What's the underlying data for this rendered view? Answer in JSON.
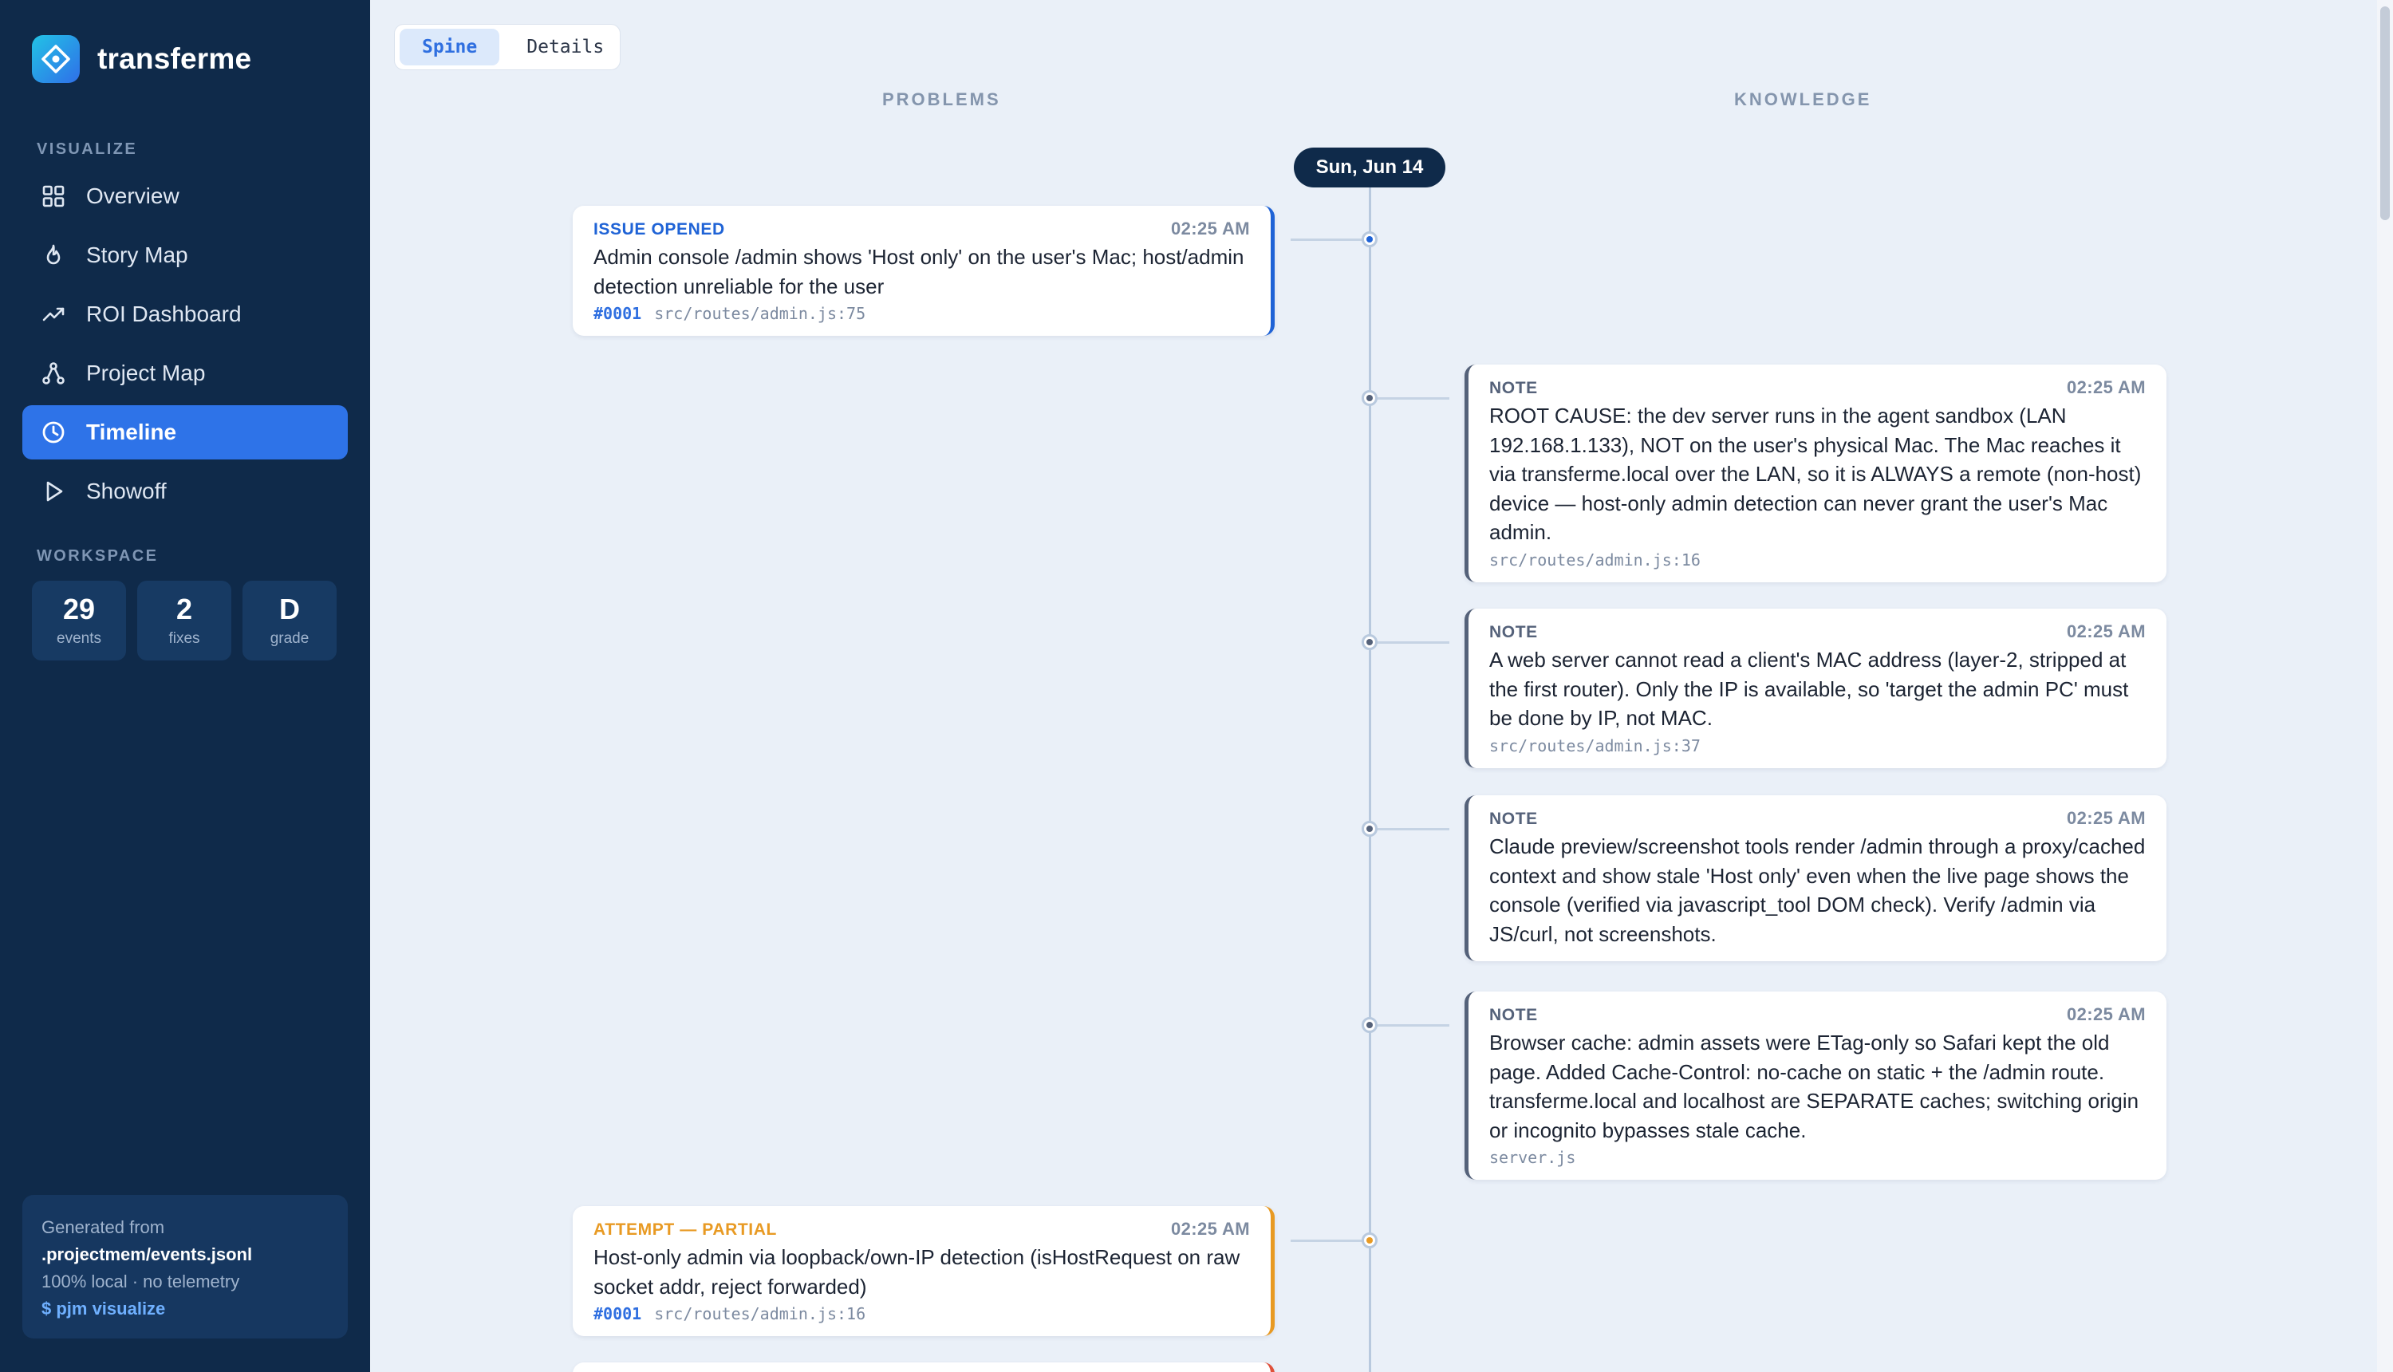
{
  "brand": {
    "name": "transferme"
  },
  "sidebar": {
    "visualize_label": "VISUALIZE",
    "nav": [
      {
        "label": "Overview",
        "icon": "grid-icon"
      },
      {
        "label": "Story Map",
        "icon": "flame-icon"
      },
      {
        "label": "ROI Dashboard",
        "icon": "trend-up-icon"
      },
      {
        "label": "Project Map",
        "icon": "graph-nodes-icon"
      },
      {
        "label": "Timeline",
        "icon": "clock-icon",
        "active": true
      },
      {
        "label": "Showoff",
        "icon": "play-icon"
      }
    ],
    "workspace_label": "WORKSPACE",
    "stats": [
      {
        "value": "29",
        "label": "events"
      },
      {
        "value": "2",
        "label": "fixes"
      },
      {
        "value": "D",
        "label": "grade"
      }
    ],
    "generated": {
      "line1": "Generated from",
      "file": ".projectmem/events.jsonl",
      "line3": "100% local · no telemetry",
      "command": "$ pjm visualize"
    }
  },
  "toggle": {
    "spine": "Spine",
    "details": "Details"
  },
  "columns": {
    "problems": "PROBLEMS",
    "knowledge": "KNOWLEDGE"
  },
  "date": "Sun, Jun 14",
  "events": [
    {
      "type": "ISSUE OPENED",
      "time": "02:25 AM",
      "text": "Admin console /admin shows 'Host only' on the user's Mac; host/admin detection unreliable for the user",
      "ref": "#0001",
      "file": "src/routes/admin.js:75"
    },
    {
      "type": "NOTE",
      "time": "02:25 AM",
      "text": "ROOT CAUSE: the dev server runs in the agent sandbox (LAN 192.168.1.133), NOT on the user's physical Mac. The Mac reaches it via transferme.local over the LAN, so it is ALWAYS a remote (non-host) device — host-only admin detection can never grant the user's Mac admin.",
      "file": "src/routes/admin.js:16"
    },
    {
      "type": "NOTE",
      "time": "02:25 AM",
      "text": "A web server cannot read a client's MAC address (layer-2, stripped at the first router). Only the IP is available, so 'target the admin PC' must be done by IP, not MAC.",
      "file": "src/routes/admin.js:37"
    },
    {
      "type": "NOTE",
      "time": "02:25 AM",
      "text": "Claude preview/screenshot tools render /admin through a proxy/cached context and show stale 'Host only' even when the live page shows the console (verified via javascript_tool DOM check). Verify /admin via JS/curl, not screenshots."
    },
    {
      "type": "NOTE",
      "time": "02:25 AM",
      "text": "Browser cache: admin assets were ETag-only so Safari kept the old page. Added Cache-Control: no-cache on static + the /admin route. transferme.local and localhost are SEPARATE caches; switching origin or incognito bypasses stale cache.",
      "file": "server.js"
    },
    {
      "type": "ATTEMPT — PARTIAL",
      "time": "02:25 AM",
      "text": "Host-only admin via loopback/own-IP detection (isHostRequest on raw socket addr, reject forwarded)",
      "ref": "#0001",
      "file": "src/routes/admin.js:16"
    }
  ],
  "colors": {
    "issue": "#1f63d6",
    "note": "#55627a",
    "attempt": "#e89a23",
    "next": "#e0503a"
  }
}
